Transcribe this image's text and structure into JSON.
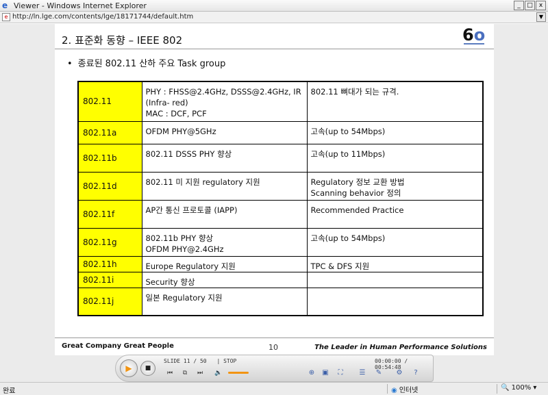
{
  "window": {
    "title": "Viewer - Windows Internet Explorer",
    "minimize": "_",
    "maximize": "□",
    "close": "x"
  },
  "address": {
    "url": "http://ln.lge.com/contents/lge/18171744/default.htm",
    "dropdown": "▼"
  },
  "slide": {
    "heading": "2. 표준화 동향 – IEEE 802",
    "logo_text": "6",
    "bullet": "종료된 802.11 산하 주요 Task group",
    "table": [
      {
        "id": "802.11",
        "col2": "PHY : FHSS@2.4GHz, DSSS@2.4GHz, IR (Infra- red)\nMAC : DCF, PCF",
        "col3": "802.11 뼈대가 되는 규격."
      },
      {
        "id": "802.11a",
        "col2": "OFDM PHY@5GHz",
        "col3": "고속(up to 54Mbps)"
      },
      {
        "id": "802.11b",
        "col2": "802.11 DSSS PHY 향상",
        "col3": "고속(up to 11Mbps)"
      },
      {
        "id": "802.11d",
        "col2": "802.11 미 지원 regulatory 지원",
        "col3": "Regulatory 정보 교환 방법\nScanning behavior 정의"
      },
      {
        "id": "802.11f",
        "col2": "AP간 통신 프로토콜 (IAPP)",
        "col3": "Recommended  Practice"
      },
      {
        "id": "802.11g",
        "col2": "802.11b PHY 향상\nOFDM PHY@2.4GHz",
        "col3": "고속(up to 54Mbps)"
      },
      {
        "id": "802.11h",
        "col2": "Europe Regulatory 지원",
        "col3": "TPC & DFS 지원"
      },
      {
        "id": "802.11i",
        "col2": "Security 향상",
        "col3": ""
      },
      {
        "id": "802.11j",
        "col2": "일본 Regulatory 지원",
        "col3": ""
      }
    ],
    "footer_left": "Great Company   Great People",
    "footer_page": "10",
    "footer_right": "The Leader in Human Performance Solutions"
  },
  "player": {
    "slide_label": "SLIDE  11 / 50",
    "state": "| STOP",
    "time": "00:00:00 / 00:54:48",
    "volume_level": 1.0
  },
  "status": {
    "text": "완료",
    "zone": "인터넷",
    "zoom": "100%"
  }
}
